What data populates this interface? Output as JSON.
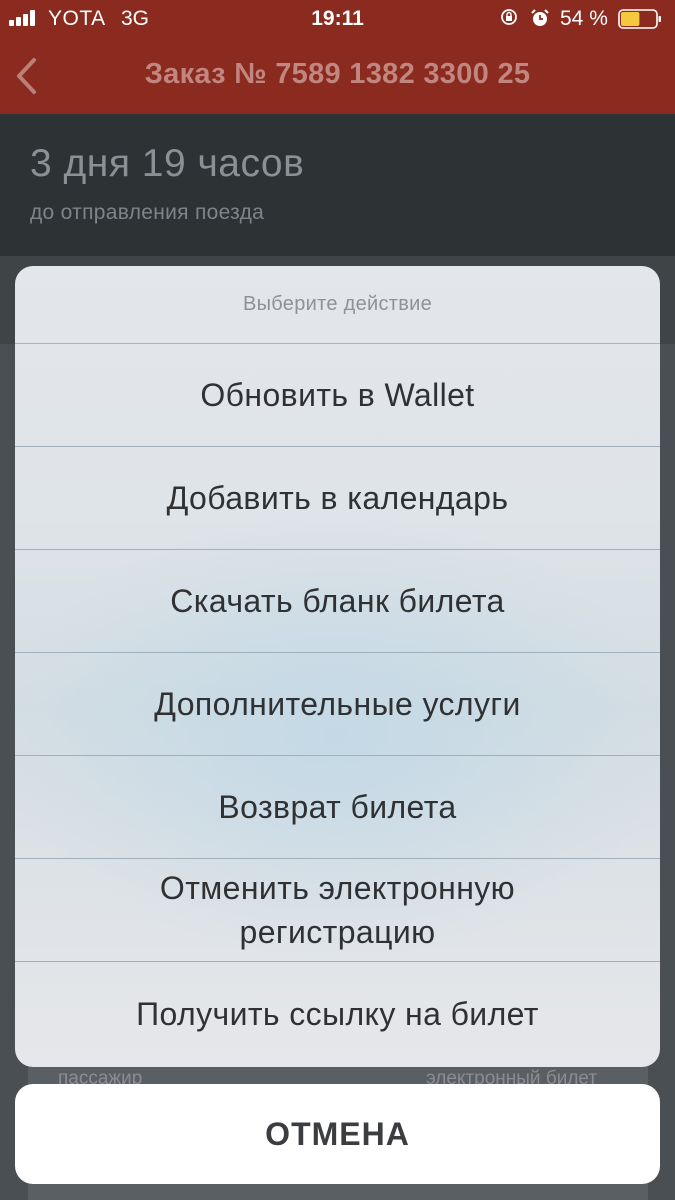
{
  "status_bar": {
    "carrier": "YOTA",
    "network": "3G",
    "time": "19:11",
    "battery_percent": "54 %",
    "signal_icon": "cellular-signal-icon",
    "lock_icon": "rotation-lock-icon",
    "alarm_icon": "alarm-clock-icon",
    "battery_icon": "battery-icon",
    "battery_level": 0.54,
    "battery_color": "#f5c93d"
  },
  "nav": {
    "back_icon": "chevron-left-icon",
    "title": "Заказ № 7589 1382 3300 25",
    "bar_color": "#8b2a1f"
  },
  "countdown": {
    "value": "3 дня 19 часов",
    "caption": "до отправления поезда"
  },
  "background_card": {
    "left_label": "пассажир",
    "right_label": "электронный билет"
  },
  "action_sheet": {
    "title": "Выберите действие",
    "items": [
      {
        "label": "Обновить в Wallet"
      },
      {
        "label": "Добавить в календарь"
      },
      {
        "label": "Скачать бланк билета"
      },
      {
        "label": "Дополнительные услуги"
      },
      {
        "label": "Возврат билета"
      },
      {
        "label": "Отменить электронную регистрацию"
      },
      {
        "label": "Получить ссылку на билет"
      }
    ],
    "cancel_label": "ОТМЕНА"
  }
}
